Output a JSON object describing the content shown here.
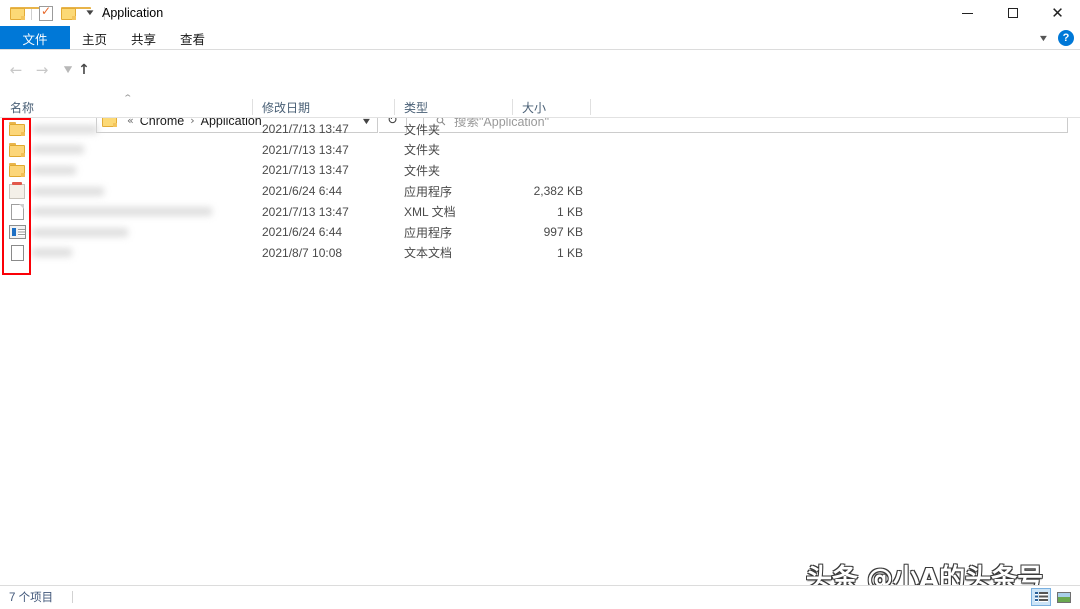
{
  "window": {
    "title": "Application",
    "quick_access": [
      {
        "name": "folder-icon",
        "label": ""
      },
      {
        "name": "properties-icon",
        "label": ""
      },
      {
        "name": "new-folder-icon",
        "label": ""
      },
      {
        "name": "customize-caret-icon",
        "label": "▼"
      }
    ],
    "controls": {
      "minimize": "─",
      "maximize": "□",
      "close": "✕"
    }
  },
  "ribbon": {
    "tabs": [
      {
        "label": "文件",
        "active": true
      },
      {
        "label": "主页",
        "active": false
      },
      {
        "label": "共享",
        "active": false
      },
      {
        "label": "查看",
        "active": false
      }
    ],
    "collapse_caret": "⌄",
    "help_label": "?"
  },
  "navigation": {
    "back": "←",
    "forward": "→",
    "recent": "⌄",
    "up": "↑",
    "refresh": "↻",
    "address_caret": "⌄",
    "breadcrumb": {
      "prefix": "«",
      "items": [
        "Chrome",
        "Application"
      ],
      "separator": "›"
    }
  },
  "search": {
    "icon": "⚲",
    "placeholder": "搜索\"Application\""
  },
  "columns": [
    {
      "label": "名称",
      "sorted": true
    },
    {
      "label": "修改日期",
      "sorted": false
    },
    {
      "label": "类型",
      "sorted": false
    },
    {
      "label": "大小",
      "sorted": false
    }
  ],
  "sort_indicator": "⌃",
  "files": [
    {
      "icon": "folder-icon",
      "name": "",
      "name_redacted": true,
      "name_width": 66,
      "date": "2021/7/13 13:47",
      "type": "文件夹",
      "size": ""
    },
    {
      "icon": "folder-icon",
      "name": "",
      "name_redacted": true,
      "name_width": 52,
      "date": "2021/7/13 13:47",
      "type": "文件夹",
      "size": ""
    },
    {
      "icon": "folder-icon",
      "name": "",
      "name_redacted": true,
      "name_width": 44,
      "date": "2021/7/13 13:47",
      "type": "文件夹",
      "size": ""
    },
    {
      "icon": "application-icon",
      "name": "",
      "name_redacted": true,
      "name_width": 72,
      "date": "2021/6/24 6:44",
      "type": "应用程序",
      "size": "2,382 KB"
    },
    {
      "icon": "document-icon",
      "name": "",
      "name_redacted": true,
      "name_width": 180,
      "date": "2021/7/13 13:47",
      "type": "XML 文档",
      "size": "1 KB"
    },
    {
      "icon": "executable-icon",
      "name": "",
      "name_redacted": true,
      "name_width": 96,
      "date": "2021/6/24 6:44",
      "type": "应用程序",
      "size": "997 KB"
    },
    {
      "icon": "text-document-icon",
      "name": "",
      "name_redacted": true,
      "name_width": 40,
      "date": "2021/8/7 10:08",
      "type": "文本文档",
      "size": "1 KB"
    }
  ],
  "annotation": {
    "color": "#fb0007",
    "target": "file-type-icons-column"
  },
  "watermark": {
    "text": "头条 @小A的头条号"
  },
  "status": {
    "item_count": "7 个项目",
    "views": [
      {
        "name": "details-view",
        "active": true
      },
      {
        "name": "large-icons-view",
        "active": false
      }
    ]
  },
  "colors": {
    "accent": "#0078d7",
    "annotation": "#fb0007",
    "folder": "#fcd679",
    "header_text": "#4a6076"
  }
}
